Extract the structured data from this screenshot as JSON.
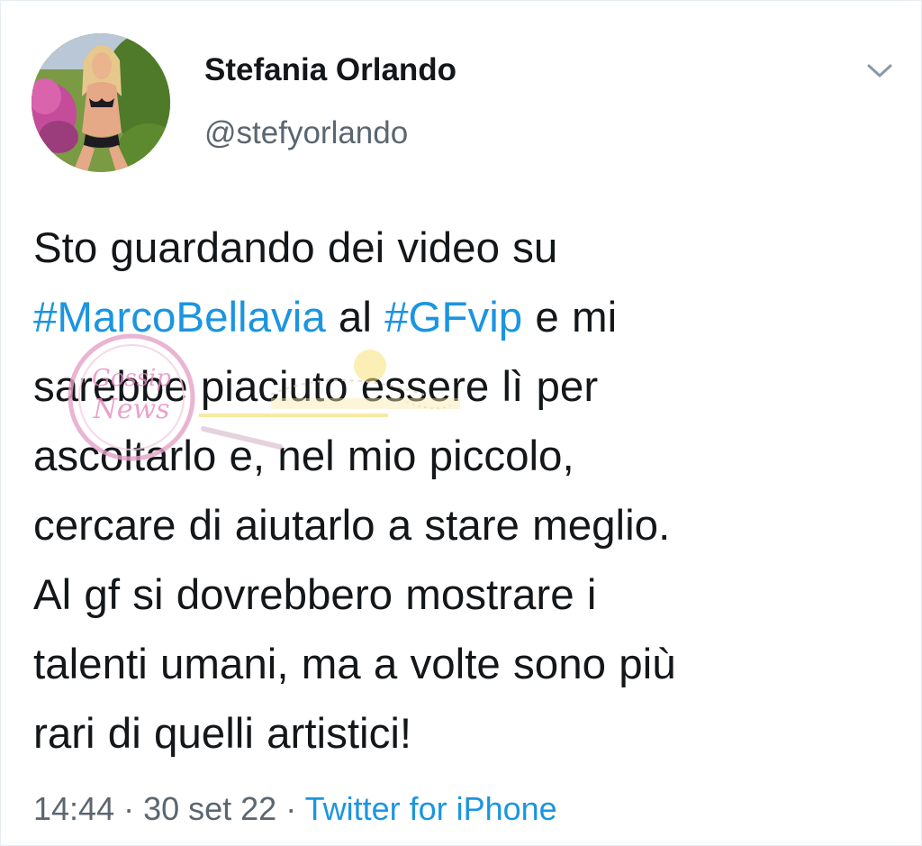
{
  "author": {
    "display_name": "Stefania Orlando",
    "handle": "@stefyorlando"
  },
  "menu": {
    "icon": "chevron-down-icon"
  },
  "tweet": {
    "lines": [
      {
        "segments": [
          {
            "text": "Sto guardando dei video su",
            "type": "text"
          }
        ]
      },
      {
        "segments": [
          {
            "text": "#MarcoBellavia",
            "type": "hashtag"
          },
          {
            "text": " al ",
            "type": "text"
          },
          {
            "text": "#GFvip",
            "type": "hashtag"
          },
          {
            "text": " e mi",
            "type": "text"
          }
        ]
      },
      {
        "segments": [
          {
            "text": "sarebbe piaciuto essere lì per",
            "type": "text"
          }
        ]
      },
      {
        "segments": [
          {
            "text": "ascoltarlo e, nel mio piccolo,",
            "type": "text"
          }
        ]
      },
      {
        "segments": [
          {
            "text": "cercare di aiutarlo a stare meglio.",
            "type": "text"
          }
        ]
      },
      {
        "segments": [
          {
            "text": "Al gf si dovrebbero mostrare i",
            "type": "text"
          }
        ]
      },
      {
        "segments": [
          {
            "text": "talenti umani, ma a volte sono più",
            "type": "text"
          }
        ]
      },
      {
        "segments": [
          {
            "text": "rari di quelli artistici!",
            "type": "text"
          }
        ]
      }
    ]
  },
  "meta": {
    "time": "14:44",
    "separator": " · ",
    "date": "30 set 22",
    "source": "Twitter for iPhone"
  },
  "watermark": {
    "text": "Gossip News"
  },
  "colors": {
    "hashtag": "#1b95e0",
    "secondary_text": "#5b6670",
    "primary_text": "#14171a"
  }
}
